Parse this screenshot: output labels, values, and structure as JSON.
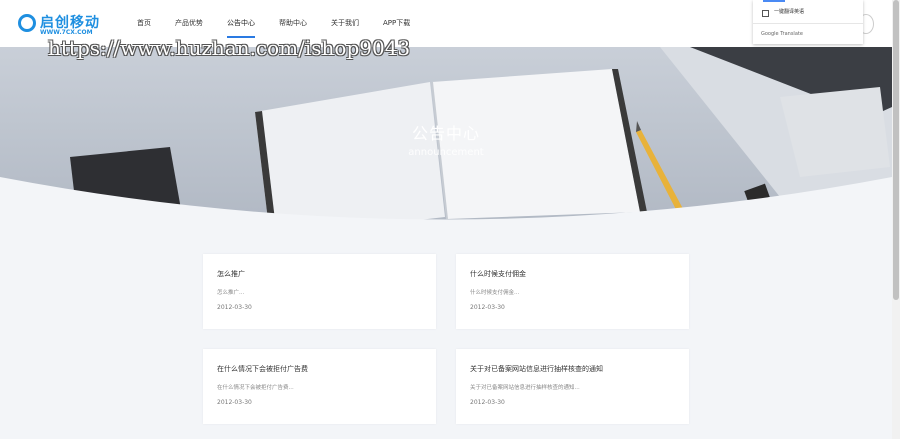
{
  "header": {
    "logo_text": "启创移动",
    "logo_sub": "WWW.7CX.COM",
    "nav": [
      {
        "label": "首页",
        "active": false
      },
      {
        "label": "产品优势",
        "active": false
      },
      {
        "label": "公告中心",
        "active": true
      },
      {
        "label": "帮助中心",
        "active": false
      },
      {
        "label": "关于我们",
        "active": false
      },
      {
        "label": "APP下载",
        "active": false
      }
    ]
  },
  "watermark": "https://www.huzhan.com/ishop9043",
  "translate_popup": {
    "option_label": "一键翻译英语",
    "brand": "Google Translate"
  },
  "hero": {
    "title": "公告中心",
    "subtitle": "announcement"
  },
  "cards": [
    {
      "title": "怎么推广",
      "summary": "怎么推广...",
      "date": "2012-03-30"
    },
    {
      "title": "什么时候支付佣金",
      "summary": "什么时候支付佣金...",
      "date": "2012-03-30"
    },
    {
      "title": "在什么情况下会被拒付广告费",
      "summary": "在什么情况下会被拒付广告费...",
      "date": "2012-03-30"
    },
    {
      "title": "关于对已备案网站信息进行抽样核查的通知",
      "summary": "关于对已备案网站信息进行抽样核查的通知...",
      "date": "2012-03-30"
    }
  ],
  "colors": {
    "brand": "#1f8fe0",
    "nav_active_underline": "#2a7ae2",
    "page_bg": "#f3f5f8"
  }
}
